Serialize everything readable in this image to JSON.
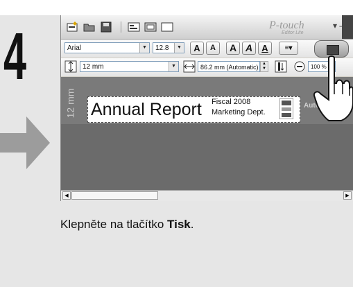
{
  "step": {
    "number": "4"
  },
  "app": {
    "brand": "P-touch",
    "brand_sub": "Editor Lite"
  },
  "toolbar1": {
    "font_name": "Arial",
    "font_size": "12.8",
    "btn_grow": "A",
    "btn_shrink": "A",
    "btn_bold": "A",
    "btn_italic": "A",
    "btn_underline": "A"
  },
  "toolbar2": {
    "tape_width": "12 mm",
    "label_length": "86.2 mm (Automatic)",
    "zoom": "100 %"
  },
  "canvas": {
    "margin_label": "12 mm",
    "auto_text": "Automatic",
    "label_main": "Annual Report",
    "label_line1": "Fiscal 2008",
    "label_line2": "Marketing Dept."
  },
  "instruction": {
    "prefix": "Klepněte na tlačítko ",
    "bold": "Tisk",
    "suffix": "."
  },
  "colors": {
    "background": "#e6e6e6",
    "canvas": "#6b6b6b",
    "step_number": "#111111"
  }
}
